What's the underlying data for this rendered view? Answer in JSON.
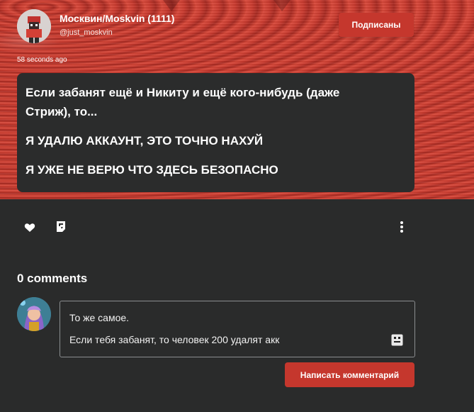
{
  "post": {
    "author_name": "Москвин/Moskvin (1111)",
    "author_handle": "@just_moskvin",
    "follow_label": "Подписаны",
    "timestamp": "58 seconds ago",
    "lines": [
      "Если забанят ещё и Никиту и ещё кого-нибудь (даже",
      "Стриж), то...",
      "Я УДАЛЮ АККАУНТ, ЭТО ТОЧНО НАХУЙ",
      "Я УЖЕ НЕ ВЕРЮ ЧТО ЗДЕСЬ БЕЗОПАСНО"
    ]
  },
  "actions": {
    "like_icon": "heart-icon",
    "repost_icon": "repost-icon",
    "more_icon": "more-vertical-icon"
  },
  "comments": {
    "count_label": "0 comments",
    "draft_lines": [
      "То же самое.",
      "Если тебя забанят, то человек 200 удалят акк"
    ],
    "submit_label": "Написать комментарий"
  },
  "colors": {
    "accent": "#c5372d",
    "page_bg": "#2a2b2b",
    "card_bg": "#2b2c2c"
  }
}
